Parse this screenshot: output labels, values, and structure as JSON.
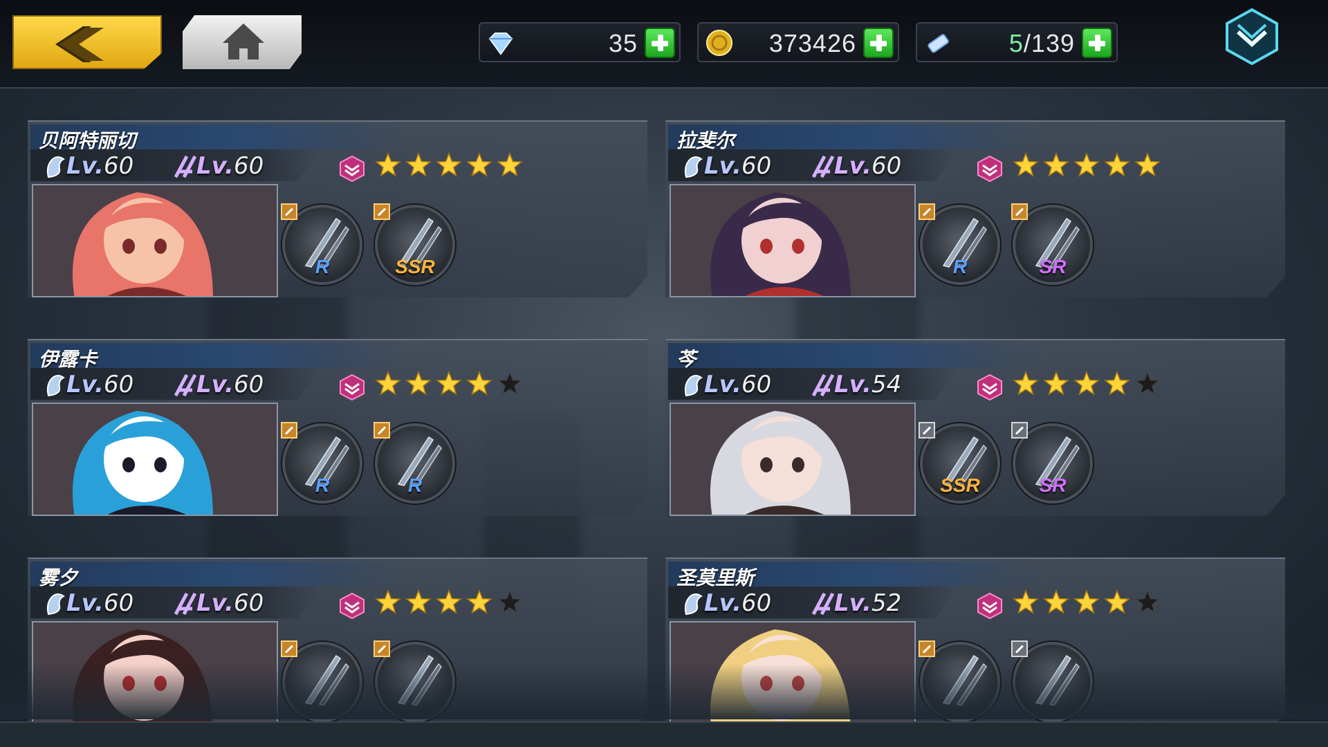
{
  "resources": {
    "diamond": {
      "value": "35",
      "icon": "diamond-icon"
    },
    "gold": {
      "value": "373426",
      "icon": "gold-coin-icon"
    },
    "stamina": {
      "current": "5",
      "max": "/139",
      "icon": "ticket-icon"
    }
  },
  "colors": {
    "back_button": "#f0c02a",
    "accent_green": "#2ec42e",
    "star_gold": "#ffd43a",
    "rank_pink": "#e040a0"
  },
  "characters": [
    {
      "name": "贝阿特丽切",
      "char_lv": "60",
      "weapon_lv": "60",
      "stars": 5,
      "max_stars": 5,
      "weapons": [
        {
          "rarity": "R",
          "tag": "gold"
        },
        {
          "rarity": "SSR",
          "tag": "gold"
        }
      ]
    },
    {
      "name": "拉斐尔",
      "char_lv": "60",
      "weapon_lv": "60",
      "stars": 5,
      "max_stars": 5,
      "weapons": [
        {
          "rarity": "R",
          "tag": "gold"
        },
        {
          "rarity": "SR",
          "tag": "gold"
        }
      ]
    },
    {
      "name": "伊露卡",
      "char_lv": "60",
      "weapon_lv": "60",
      "stars": 4,
      "max_stars": 5,
      "weapons": [
        {
          "rarity": "R",
          "tag": "gold"
        },
        {
          "rarity": "R",
          "tag": "gold"
        }
      ]
    },
    {
      "name": "芩",
      "char_lv": "60",
      "weapon_lv": "54",
      "stars": 4,
      "max_stars": 5,
      "weapons": [
        {
          "rarity": "SSR",
          "tag": "grey"
        },
        {
          "rarity": "SR",
          "tag": "grey"
        }
      ]
    },
    {
      "name": "雾夕",
      "char_lv": "60",
      "weapon_lv": "60",
      "stars": 4,
      "max_stars": 5,
      "weapons": [
        {
          "rarity": "",
          "tag": "gold"
        },
        {
          "rarity": "",
          "tag": "gold"
        }
      ]
    },
    {
      "name": "圣莫里斯",
      "char_lv": "60",
      "weapon_lv": "52",
      "stars": 4,
      "max_stars": 5,
      "weapons": [
        {
          "rarity": "",
          "tag": "gold"
        },
        {
          "rarity": "",
          "tag": "grey"
        }
      ]
    }
  ]
}
